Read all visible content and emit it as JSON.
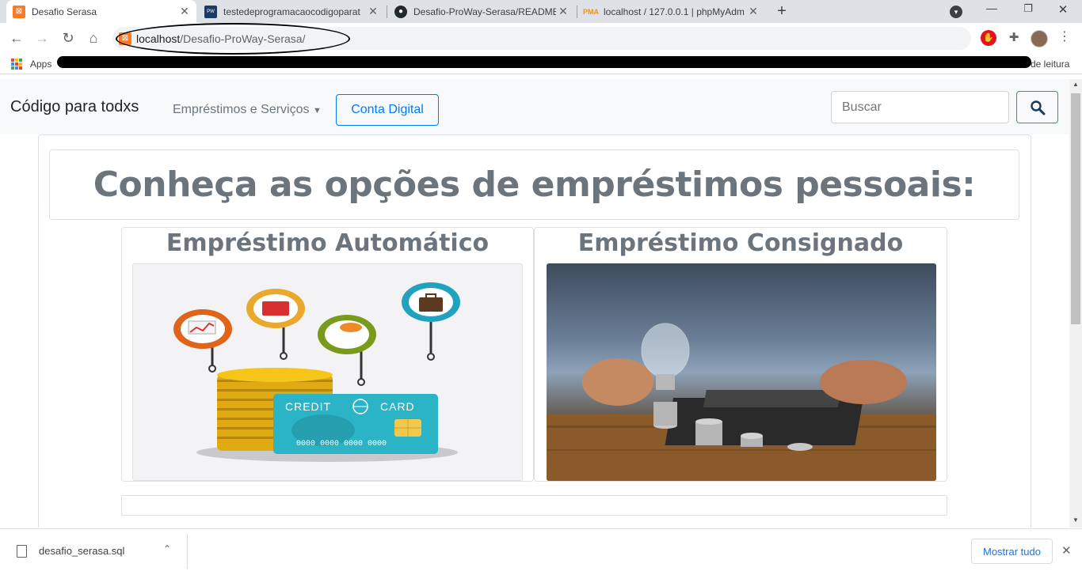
{
  "browser": {
    "tabs": [
      {
        "title": "Desafio Serasa",
        "active": true
      },
      {
        "title": "testedeprogramacaocodigoparat"
      },
      {
        "title": "Desafio-ProWay-Serasa/README"
      },
      {
        "title": "localhost / 127.0.0.1 | phpMyAdm"
      }
    ],
    "new_tab": "+",
    "url_host": "localhost",
    "url_path": "/Desafio-ProWay-Serasa/",
    "bookmarks": {
      "apps_label": "Apps",
      "reading_list": "de leitura"
    }
  },
  "navbar": {
    "brand": "Código para todxs",
    "dropdown": "Empréstimos e Serviços",
    "digital_button": "Conta Digital",
    "search_placeholder": "Buscar"
  },
  "main": {
    "heading": "Conheça as opções de empréstimos pessoais:",
    "cards": [
      {
        "title": "Empréstimo Automático",
        "card_text_1": "CREDIT",
        "card_text_2": "CARD",
        "card_number": "0000 0000 0000 0000"
      },
      {
        "title": "Empréstimo Consignado"
      }
    ]
  },
  "downloads": {
    "file_name": "desafio_serasa.sql",
    "show_all": "Mostrar tudo"
  },
  "colors": {
    "heading": "#6c757d",
    "accent": "#007bff",
    "success": "#28a745"
  }
}
